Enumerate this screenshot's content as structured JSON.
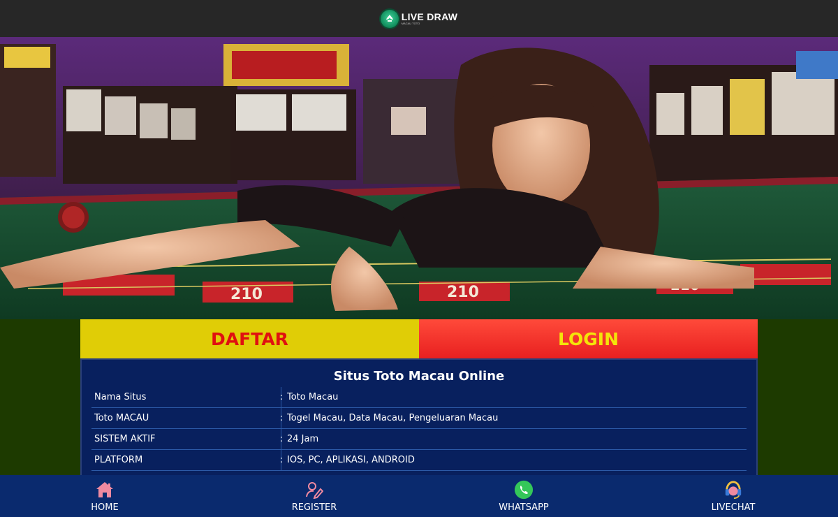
{
  "header": {
    "logo_text": "LIVE DRAW",
    "logo_sub": "MACAU TOTO"
  },
  "hero": {
    "overlay_texts": [
      "210",
      "210",
      "210"
    ]
  },
  "buttons": {
    "daftar": "DAFTAR",
    "login": "LOGIN"
  },
  "info": {
    "title": "Situs Toto Macau Online",
    "rows": [
      {
        "key": "Nama Situs",
        "value": "Toto Macau"
      },
      {
        "key": "Toto MACAU",
        "value": "Togel Macau, Data Macau, Pengeluaran Macau"
      },
      {
        "key": "SISTEM AKTIF",
        "value": "24 Jam"
      },
      {
        "key": "PLATFORM",
        "value": "IOS, PC, APLIKASI, ANDROID"
      }
    ],
    "separator": ":"
  },
  "bottom_nav": {
    "items": [
      {
        "label": "HOME",
        "icon": "home-icon"
      },
      {
        "label": "REGISTER",
        "icon": "register-icon"
      },
      {
        "label": "WHATSAPP",
        "icon": "whatsapp-icon"
      },
      {
        "label": "LIVECHAT",
        "icon": "livechat-icon"
      }
    ]
  },
  "colors": {
    "page_bg": "#1d3a00",
    "header_bg": "#272727",
    "daftar_bg": "#e0cd06",
    "daftar_text": "#e01010",
    "login_bg": "#ff3a2a",
    "login_text": "#f4e40a",
    "panel_bg": "#08205e",
    "nav_bg": "#0a2a6e"
  }
}
